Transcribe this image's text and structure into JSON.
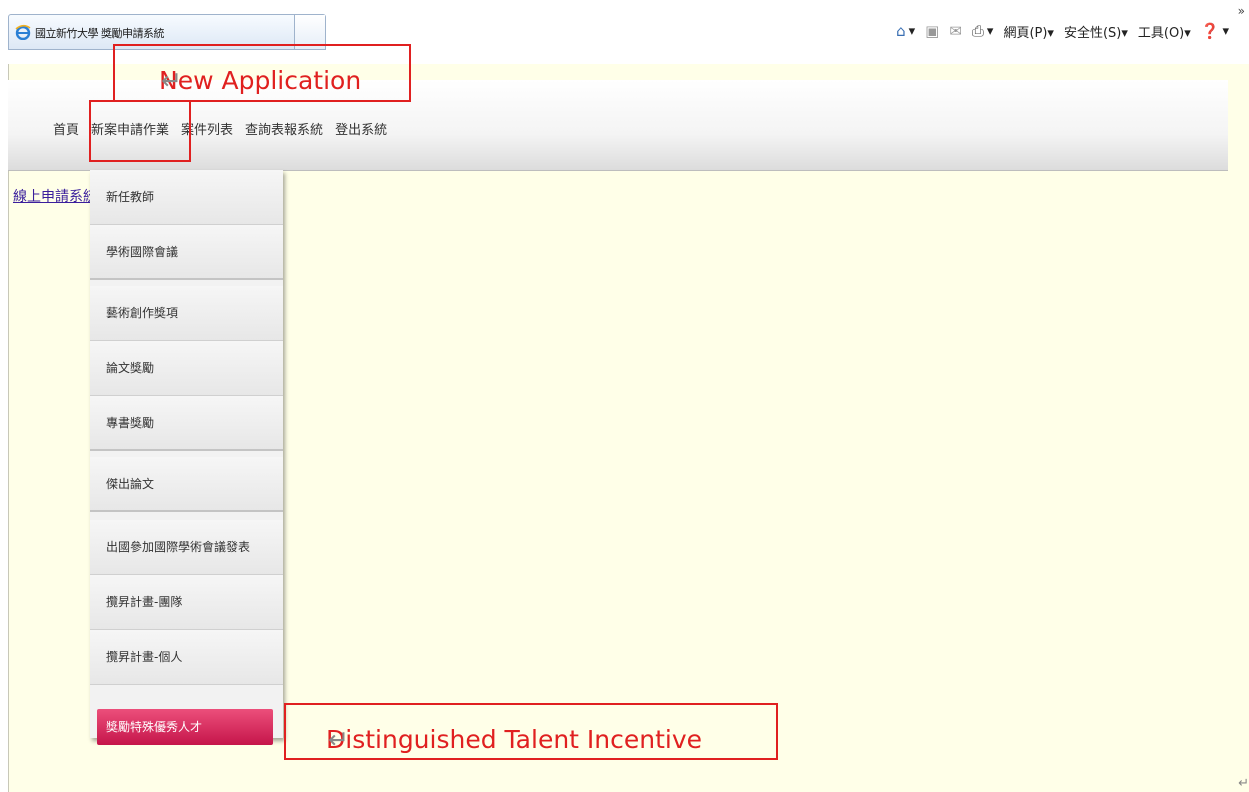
{
  "browser": {
    "tab_title": "國立新竹大學 獎勵申請系統",
    "toolbar": [
      {
        "icon": "home-icon",
        "label": "▾"
      },
      {
        "icon": "feeds-icon",
        "label": ""
      },
      {
        "icon": "mail-icon",
        "label": ""
      },
      {
        "icon": "print-icon",
        "label": "▾"
      },
      {
        "icon": "page-menu",
        "label": "網頁(P)▾"
      },
      {
        "icon": "safety-menu",
        "label": "安全性(S)▾"
      },
      {
        "icon": "tools-menu",
        "label": "工具(O)▾"
      },
      {
        "icon": "help-icon",
        "label": "▾"
      }
    ],
    "more_glyph": "»"
  },
  "nav": {
    "items": [
      "首頁",
      "新案申請作業",
      "案件列表",
      "查詢表報系統",
      "登出系統"
    ]
  },
  "side_link": "線上申請系統",
  "dropdown": {
    "items": [
      "新任教師",
      "學術國際會議",
      "藝術創作獎項",
      "論文獎勵",
      "專書獎勵",
      "傑出論文",
      "出國參加國際學術會議發表",
      "攬昇計畫-團隊",
      "攬昇計畫-個人",
      "獎勵特殊優秀人才"
    ],
    "active_index": 9
  },
  "annotations": {
    "new_application": "New Application",
    "distinguished_talent": "Distinguished Talent Incentive",
    "return_mark": "↵",
    "accent_color": "#e02020"
  }
}
